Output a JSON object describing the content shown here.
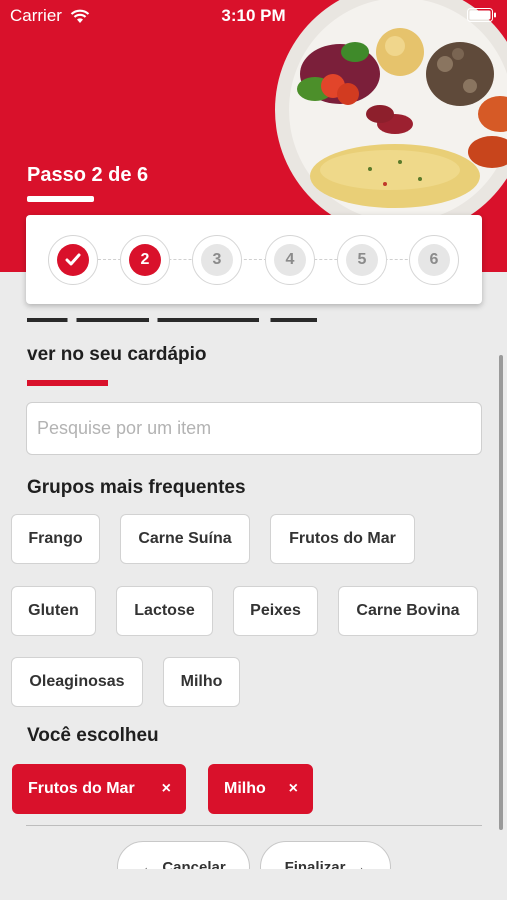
{
  "status_bar": {
    "carrier": "Carrier",
    "time": "3:10 PM"
  },
  "step": {
    "title": "Passo 2 de 6"
  },
  "stepper": {
    "steps": [
      "",
      "2",
      "3",
      "4",
      "5",
      "6"
    ]
  },
  "question": {
    "visible_line": "ver no seu cardápio"
  },
  "search": {
    "placeholder": "Pesquise por um item",
    "value": ""
  },
  "groups": {
    "title": "Grupos mais frequentes",
    "items": [
      "Frango",
      "Carne Suína",
      "Frutos do Mar",
      "Gluten",
      "Lactose",
      "Peixes",
      "Carne Bovina",
      "Oleaginosas",
      "Milho"
    ]
  },
  "selected": {
    "title": "Você escolheu",
    "items": [
      "Frutos do Mar",
      "Milho"
    ],
    "remove_symbol": "×"
  },
  "actions": {
    "cancel": "Cancelar",
    "finish": "Finalizar"
  },
  "colors": {
    "accent": "#d9112b",
    "background": "#ebebeb"
  }
}
